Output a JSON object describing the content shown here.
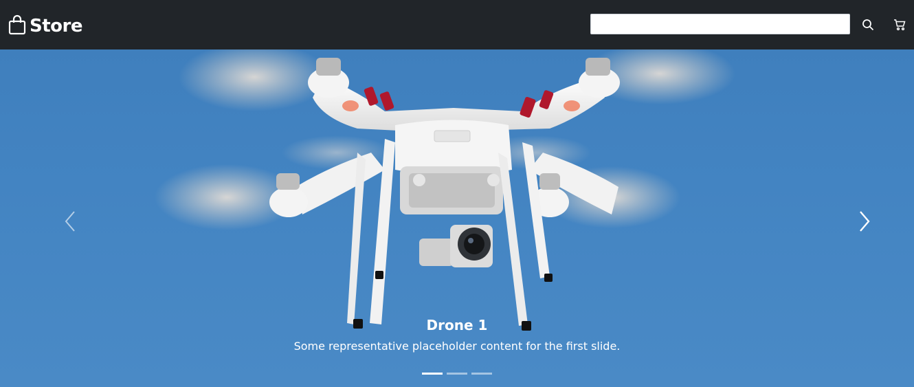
{
  "navbar": {
    "brand": "Store",
    "search": {
      "value": "",
      "placeholder": ""
    },
    "icons": {
      "brand": "shopping-bag-icon",
      "search": "search-icon",
      "cart": "cart-icon"
    }
  },
  "carousel": {
    "slides": [
      {
        "title": "Drone 1",
        "text": "Some representative placeholder content for the first slide."
      }
    ],
    "indicator_count": 3,
    "active_index": 0,
    "icons": {
      "prev": "chevron-left-icon",
      "next": "chevron-right-icon"
    }
  },
  "colors": {
    "navbar_bg": "#212529",
    "sky": "#4384c2",
    "drone_red": "#b0182c"
  }
}
